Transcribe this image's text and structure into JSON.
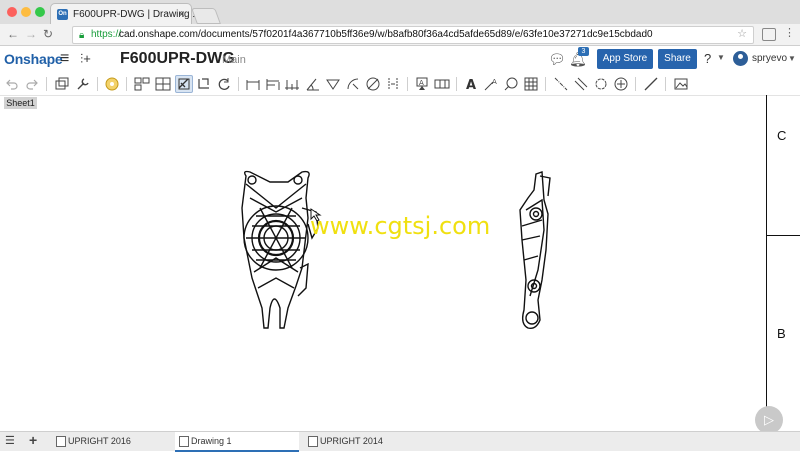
{
  "browser": {
    "tab_title": "F600UPR-DWG | Drawing 1",
    "tab_favicon": "On",
    "url_scheme": "https://",
    "url_rest": "cad.onshape.com/documents/57f0201f4a367710b5ff36e9/w/b8afb80f36a4cd5afde65d89/e/63fe10e37271dc9e15cbdad0",
    "traffic_lights": [
      "#fc605c",
      "#fdbc40",
      "#34c84a"
    ]
  },
  "header": {
    "logo": "Onshape",
    "doc_title": "F600UPR-DWG",
    "branch": "Main",
    "notification_count": "3",
    "app_store_label": "App Store",
    "share_label": "Share",
    "help_label": "?",
    "username": "spryevo",
    "accent": "#2764ad"
  },
  "sheet": {
    "tab_label": "Sheet1",
    "border_label_top": "C",
    "border_label_bottom": "B",
    "watermark": "www.cgtsj.com"
  },
  "bottom_tabs": [
    {
      "label": "UPRIGHT 2016"
    },
    {
      "label": "Drawing 1",
      "active": true
    },
    {
      "label": "UPRIGHT 2014"
    }
  ]
}
